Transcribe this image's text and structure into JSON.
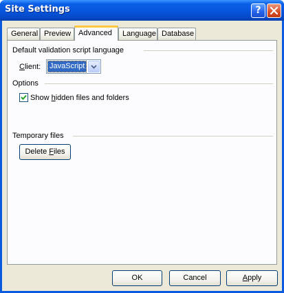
{
  "window": {
    "title": "Site Settings",
    "help_label": "?"
  },
  "tabs": [
    {
      "label": "General",
      "active": false
    },
    {
      "label": "Preview",
      "active": false
    },
    {
      "label": "Advanced",
      "active": true
    },
    {
      "label": "Language",
      "active": false
    },
    {
      "label": "Database",
      "active": false
    }
  ],
  "advanced": {
    "validation_group": {
      "title": "Default validation script language",
      "client_label_prefix": "",
      "client_label_accel": "C",
      "client_label_rest": "lient:",
      "client_value": "JavaScript"
    },
    "options_group": {
      "title": "Options",
      "show_hidden": {
        "label_prefix": "Show ",
        "label_accel": "h",
        "label_rest": "idden files and folders",
        "checked": true
      }
    },
    "temp_group": {
      "title": "Temporary files",
      "delete_prefix": "Delete ",
      "delete_accel": "F",
      "delete_rest": "iles"
    }
  },
  "footer": {
    "ok_label": "OK",
    "cancel_label": "Cancel",
    "apply_accel": "A",
    "apply_rest": "pply"
  },
  "colors": {
    "titlebar": "#0655dd",
    "dialog_bg": "#ece9d8",
    "tab_highlight": "#ffc83c",
    "selection": "#316ac5"
  }
}
